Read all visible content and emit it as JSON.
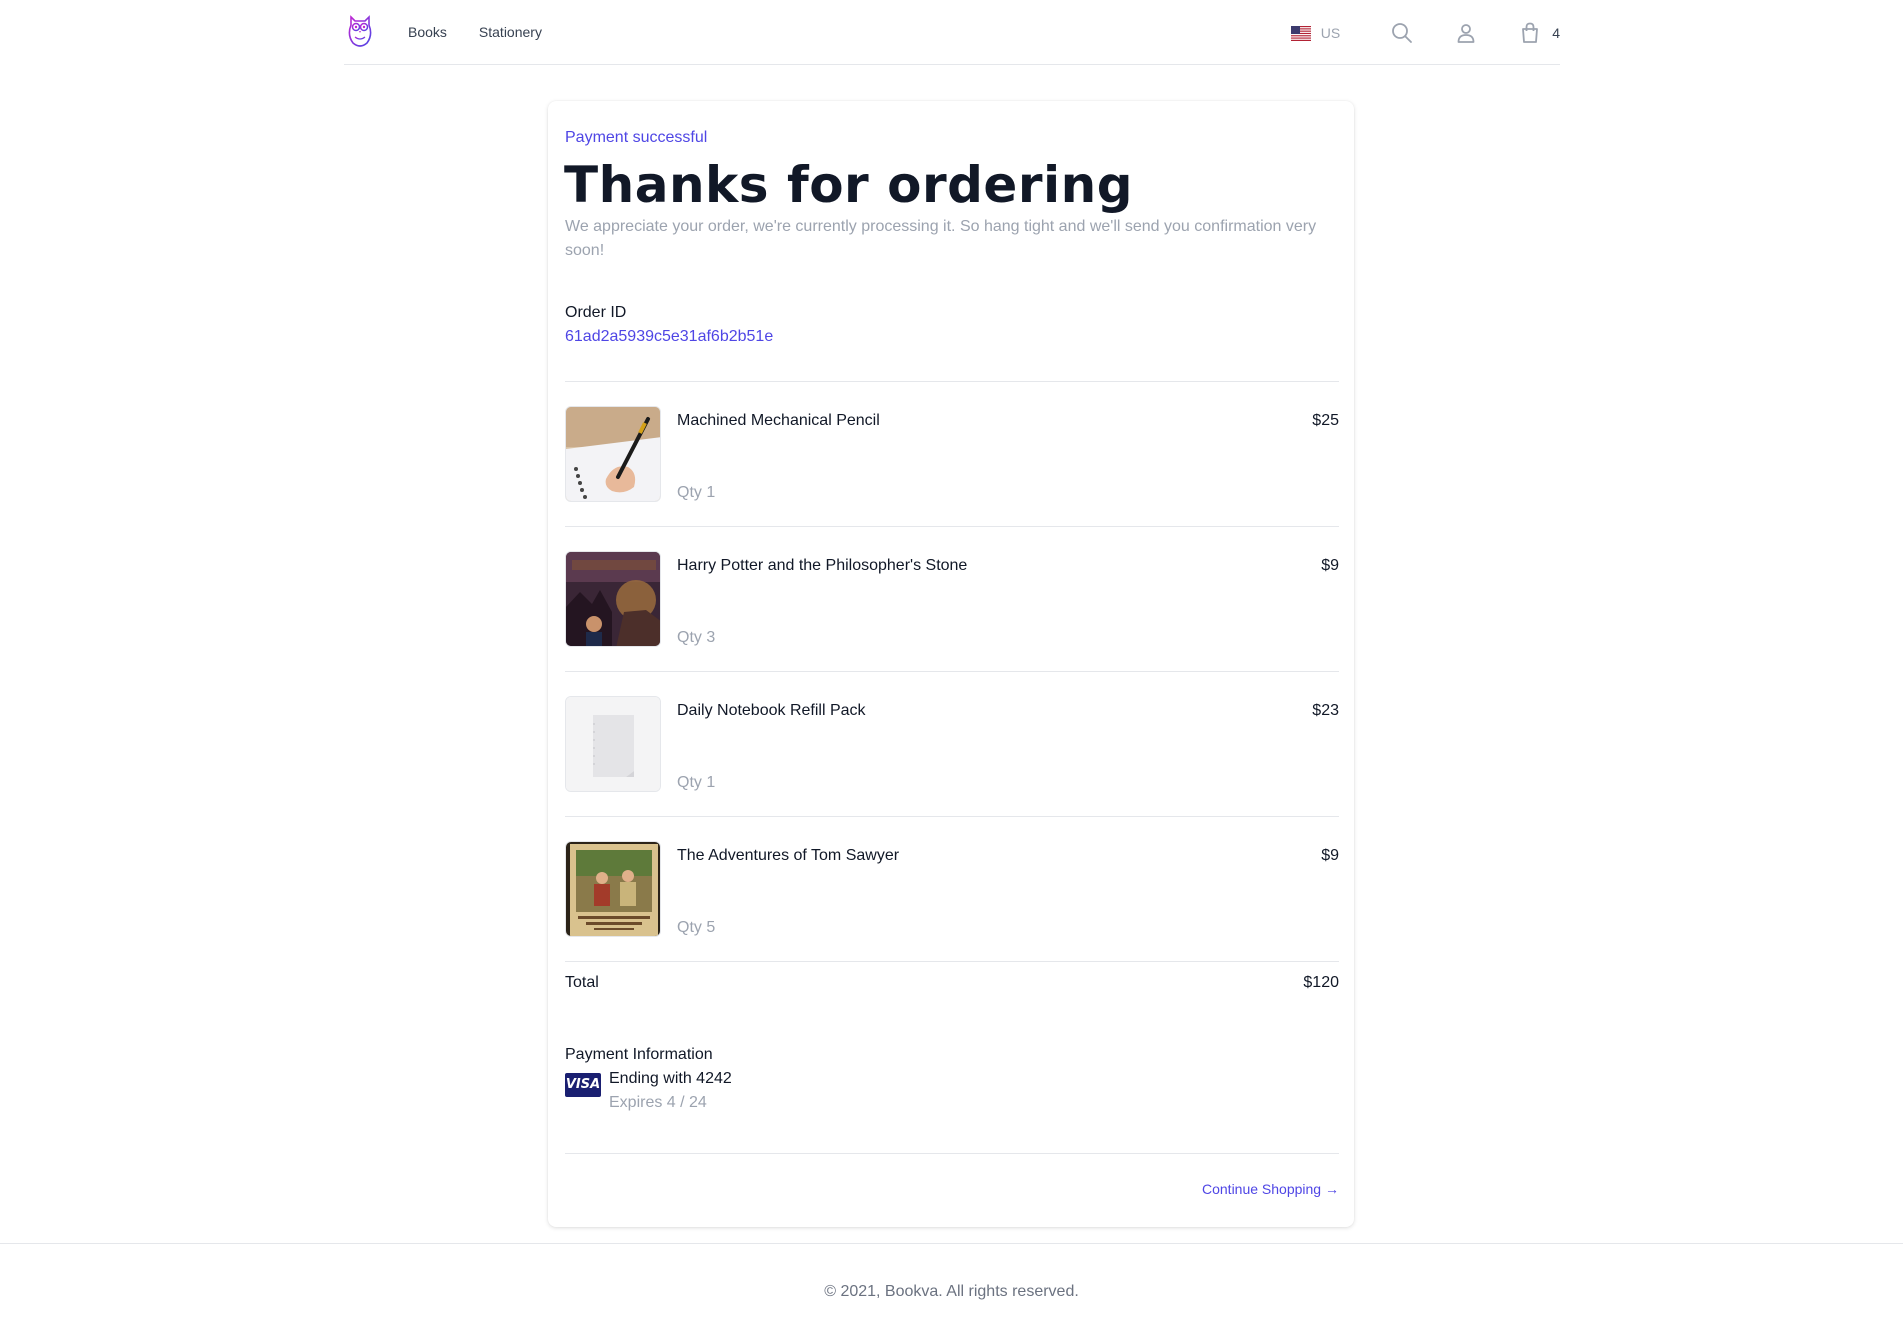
{
  "header": {
    "logo_icon": "owl-logo-icon",
    "nav": [
      "Books",
      "Stationery"
    ],
    "locale": "US",
    "cart_count": "4",
    "icons": [
      "us-flag-icon",
      "search-icon",
      "user-icon",
      "shopping-bag-icon"
    ]
  },
  "confirmation": {
    "status": "Payment successful",
    "title": "Thanks for ordering",
    "description": "We appreciate your order, we're currently processing it. So hang tight and we'll send you confirmation very soon!",
    "order_id_label": "Order ID",
    "order_id": "61ad2a5939c5e31af6b2b51e"
  },
  "items": [
    {
      "name": "Machined Mechanical Pencil",
      "price": "$25",
      "qty": "Qty 1",
      "image": "pencil-writing-photo"
    },
    {
      "name": "Harry Potter and the Philosopher's Stone",
      "price": "$9",
      "qty": "Qty 3",
      "image": "harry-potter-book-cover"
    },
    {
      "name": "Daily Notebook Refill Pack",
      "price": "$23",
      "qty": "Qty 1",
      "image": "notebook-refill-photo"
    },
    {
      "name": "The Adventures of Tom Sawyer",
      "price": "$9",
      "qty": "Qty 5",
      "image": "tom-sawyer-book-cover"
    }
  ],
  "total": {
    "label": "Total",
    "value": "$120"
  },
  "payment": {
    "label": "Payment Information",
    "brand": "VISA",
    "ending": "Ending with 4242",
    "expires": "Expires 4 / 24"
  },
  "continue_label": "Continue Shopping →",
  "footer": {
    "copyright": "© 2021, Bookva. All rights reserved."
  },
  "colors": {
    "accent": "#4f46e5",
    "muted": "#9ca3af",
    "text": "#111827",
    "visa": "#1a1f71"
  }
}
